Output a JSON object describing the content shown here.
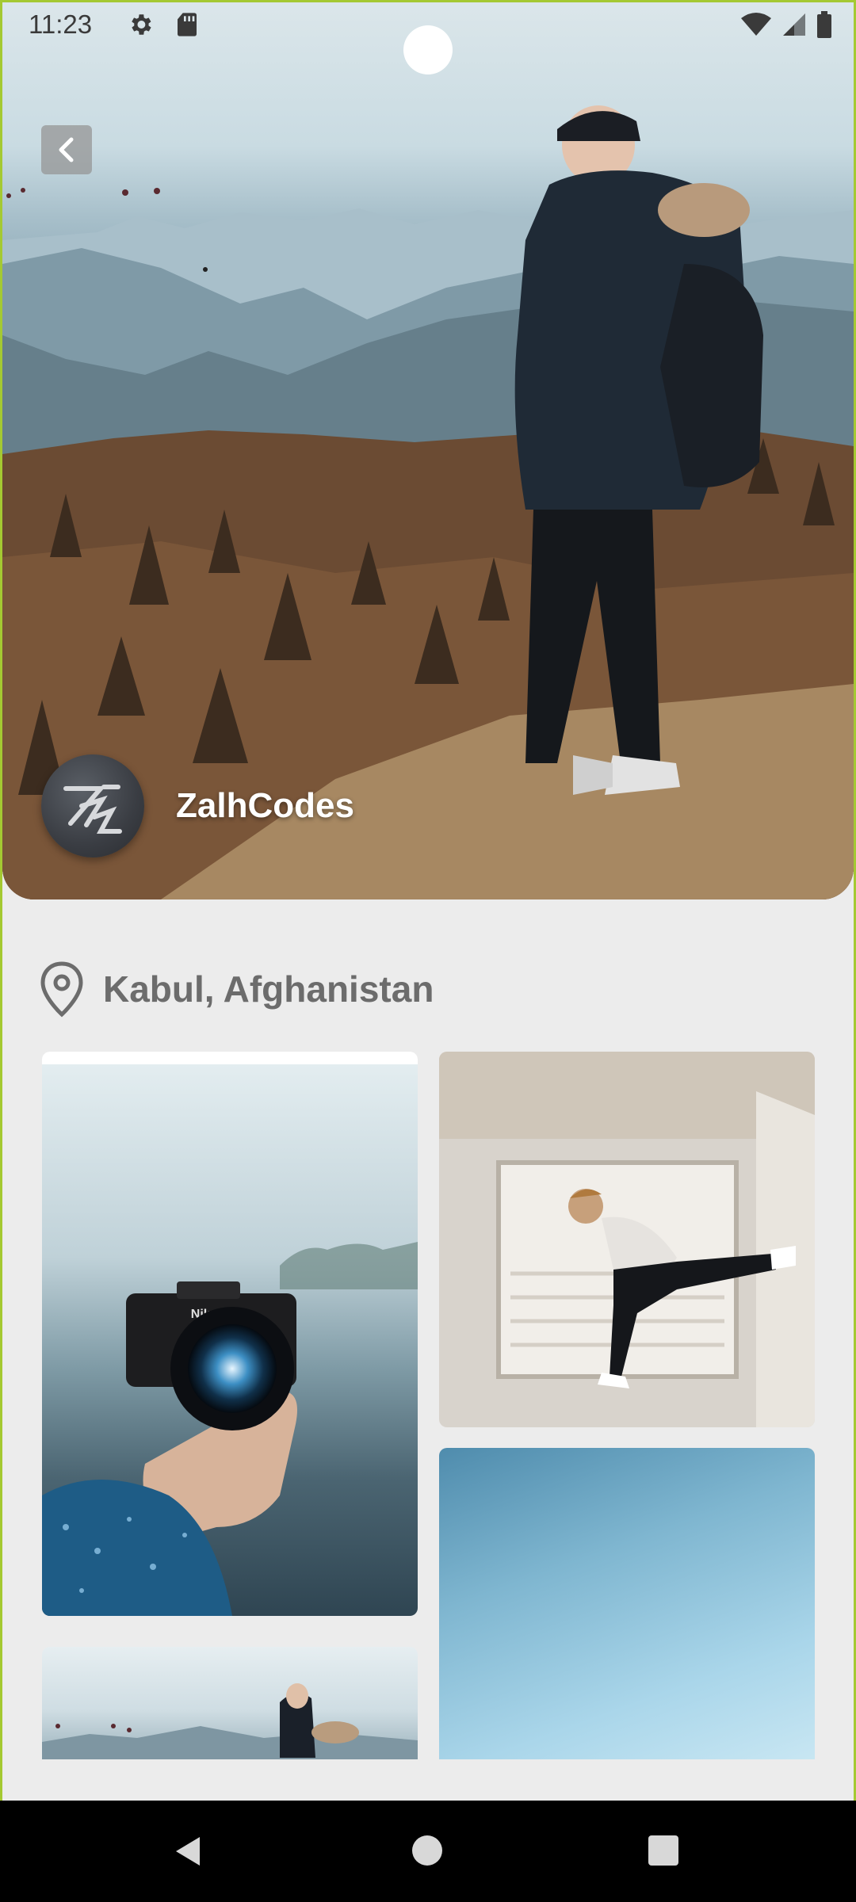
{
  "status_bar": {
    "time": "11:23",
    "icons": [
      "gear-icon",
      "sd-card-icon",
      "wifi-icon",
      "signal-icon",
      "battery-icon"
    ]
  },
  "header": {
    "back_icon": "chevron-left-icon",
    "username": "ZalhCodes",
    "avatar_icon": "zalhcodes-logo"
  },
  "location": {
    "icon": "map-pin-icon",
    "text": "Kabul, Afghanistan"
  },
  "gallery": {
    "tiles": [
      "camera-in-hand-photo",
      "man-jumping-wall-photo",
      "blue-sky-photo",
      "hiker-mountain-photo"
    ]
  },
  "nav_bar": {
    "icons": [
      "back-triangle-icon",
      "home-circle-icon",
      "recents-square-icon"
    ]
  },
  "colors": {
    "accent_border": "#a4c932",
    "background": "#ececec",
    "location_text": "#6c6c6c"
  }
}
